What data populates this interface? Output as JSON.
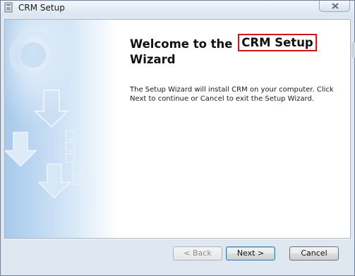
{
  "window": {
    "title": "CRM Setup",
    "app_icon": "installer-icon",
    "close_icon": "close-icon"
  },
  "welcome": {
    "heading_prefix": "Welcome to the",
    "heading_highlight": "CRM Setup",
    "heading_line2": "Wizard",
    "highlight_color": "#d4141a",
    "body": "The Setup Wizard will install CRM on your computer.  Click Next to continue or Cancel to exit the Setup Wizard."
  },
  "buttons": {
    "back": "< Back",
    "next": "Next >",
    "cancel": "Cancel"
  },
  "colors": {
    "banner_blue": "#9fc4ea",
    "window_frame": "#dfe8f1"
  }
}
